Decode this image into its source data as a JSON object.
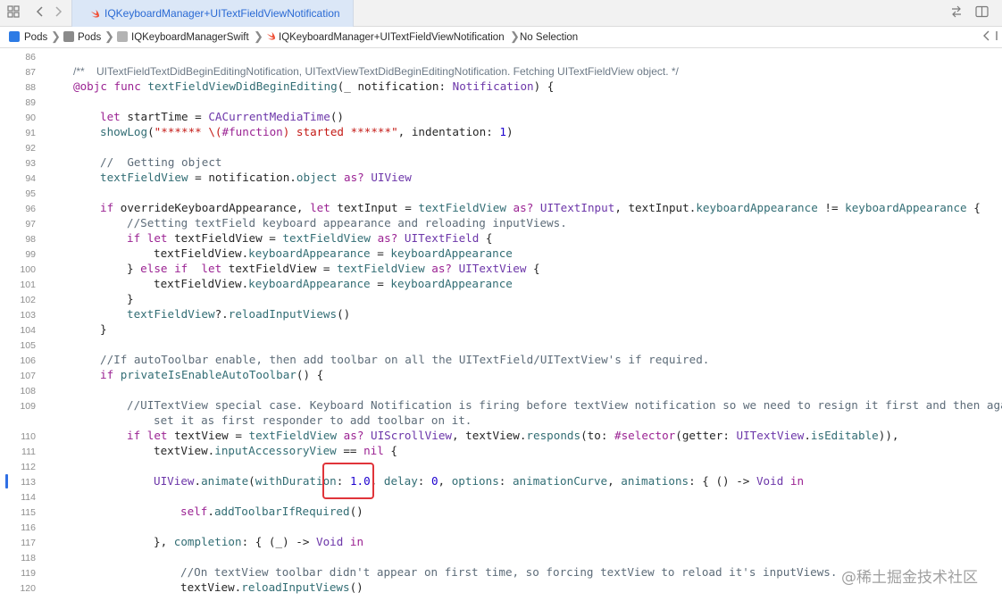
{
  "tabbar": {
    "active_tab": "IQKeyboardManager+UITextFieldViewNotification"
  },
  "jumpbar": {
    "items": [
      "Pods",
      "Pods",
      "IQKeyboardManagerSwift",
      "IQKeyboardManager+UITextFieldViewNotification",
      "No Selection"
    ]
  },
  "editor": {
    "line_numbers": [
      "86",
      "87",
      "88",
      "89",
      "90",
      "91",
      "92",
      "93",
      "94",
      "95",
      "96",
      "97",
      "98",
      "99",
      "100",
      "101",
      "102",
      "103",
      "104",
      "105",
      "106",
      "107",
      "108",
      "109",
      "",
      "110",
      "111",
      "112",
      "113",
      "114",
      "115",
      "116",
      "117",
      "118",
      "119",
      "120"
    ],
    "code": {
      "l87_doc": "/**    UITextFieldTextDidBeginEditingNotification, UITextViewTextDidBeginEditingNotification. Fetching UITextFieldView object. */",
      "l88_a": "@objc func ",
      "l88_b": "textFieldViewDidBeginEditing",
      "l88_c": "(_ notification: ",
      "l88_d": "Notification",
      "l88_e": ") {",
      "l90_a": "let",
      "l90_b": " startTime = ",
      "l90_c": "CACurrentMediaTime",
      "l90_d": "()",
      "l91_a": "showLog",
      "l91_b": "(",
      "l91_c": "\"****** \\(",
      "l91_d": "#function",
      "l91_e": ") started ******\"",
      "l91_f": ", indentation: ",
      "l91_g": "1",
      "l91_h": ")",
      "l93": "//  Getting object",
      "l94_a": "textFieldView",
      "l94_b": " = notification.",
      "l94_c": "object",
      "l94_d": " as?",
      "l94_e": " UIView",
      "l96_a": "if",
      "l96_b": " overrideKeyboardAppearance, ",
      "l96_c": "let",
      "l96_d": " textInput = ",
      "l96_e": "textFieldView",
      "l96_f": " as?",
      "l96_g": " UITextInput",
      "l96_h": ", textInput.",
      "l96_i": "keyboardAppearance",
      "l96_j": " != ",
      "l96_k": "keyboardAppearance",
      "l96_l": " {",
      "l97": "//Setting textField keyboard appearance and reloading inputViews.",
      "l98_a": "if let",
      "l98_b": " textFieldView = ",
      "l98_c": "textFieldView",
      "l98_d": " as?",
      "l98_e": " UITextField",
      "l98_f": " {",
      "l99_a": "textFieldView.",
      "l99_b": "keyboardAppearance",
      "l99_c": " = ",
      "l99_d": "keyboardAppearance",
      "l100_a": "} ",
      "l100_b": "else if  let",
      "l100_c": " textFieldView = ",
      "l100_d": "textFieldView",
      "l100_e": " as?",
      "l100_f": " UITextView",
      "l100_g": " {",
      "l101_a": "textFieldView.",
      "l101_b": "keyboardAppearance",
      "l101_c": " = ",
      "l101_d": "keyboardAppearance",
      "l102": "}",
      "l103_a": "textFieldView",
      "l103_b": "?.",
      "l103_c": "reloadInputViews",
      "l103_d": "()",
      "l104": "}",
      "l106": "//If autoToolbar enable, then add toolbar on all the UITextField/UITextView's if required.",
      "l107_a": "if",
      "l107_b": " privateIsEnableAutoToolbar",
      "l107_c": "() {",
      "l109a": "//UITextView special case. Keyboard Notification is firing before textView notification so we need to resign it first and then again",
      "l109b": "set it as first responder to add toolbar on it.",
      "l110_a": "if let",
      "l110_b": " textView = ",
      "l110_c": "textFieldView",
      "l110_d": " as?",
      "l110_e": " UIScrollView",
      "l110_f": ", textView.",
      "l110_g": "responds",
      "l110_h": "(to: ",
      "l110_i": "#selector",
      "l110_j": "(getter: ",
      "l110_k": "UITextView",
      "l110_l": ".",
      "l110_m": "isEditable",
      "l110_n": ")),",
      "l111_a": "textView.",
      "l111_b": "inputAccessoryView",
      "l111_c": " == ",
      "l111_d": "nil",
      "l111_e": " {",
      "l113_a": "UIView",
      "l113_b": ".",
      "l113_c": "animate",
      "l113_d": "(",
      "l113_e": "withDuration",
      "l113_f": ": ",
      "l113_g": "1.0",
      "l113_h": ", ",
      "l113_i": "delay",
      "l113_j": ": ",
      "l113_k": "0",
      "l113_l": ", ",
      "l113_m": "options",
      "l113_n": ": ",
      "l113_o": "animationCurve",
      "l113_p": ", ",
      "l113_q": "animations",
      "l113_r": ": { () -> ",
      "l113_s": "Void",
      "l113_t": " in",
      "l115_a": "self",
      "l115_b": ".",
      "l115_c": "addToolbarIfRequired",
      "l115_d": "()",
      "l117_a": "}, ",
      "l117_b": "completion",
      "l117_c": ": { (_) -> ",
      "l117_d": "Void",
      "l117_e": " in",
      "l119": "//On textView toolbar didn't appear on first time, so forcing textView to reload it's inputViews.",
      "l120_a": "textView.",
      "l120_b": "reloadInputViews",
      "l120_c": "()"
    }
  },
  "watermark": "@稀土掘金技术社区",
  "colors": {
    "keyword": "#9b2393",
    "function": "#326d74",
    "type": "#6c36a9",
    "comment": "#5d6c79",
    "string": "#c41a16",
    "number": "#1c00cf",
    "highlight_box": "#e0343a"
  }
}
